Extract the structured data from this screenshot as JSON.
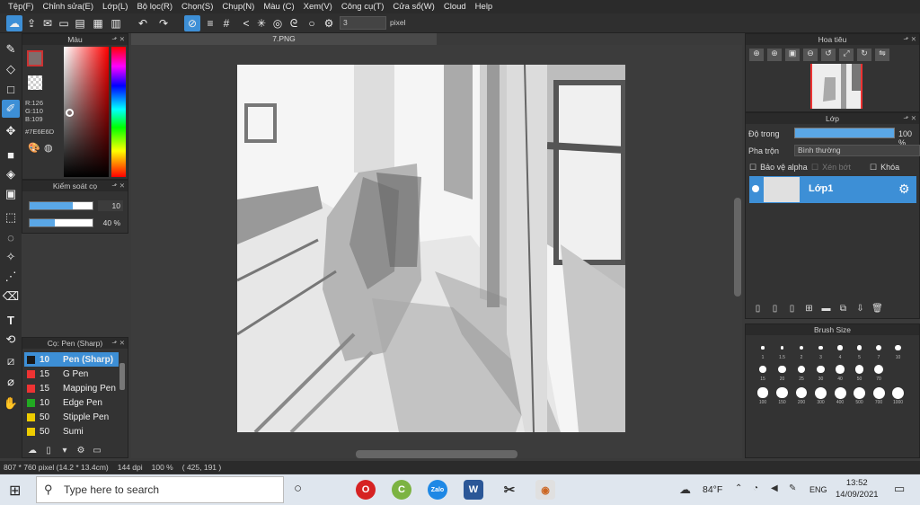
{
  "menu": [
    "Tệp(F)",
    "Chỉnh sửa(E)",
    "Lớp(L)",
    "Bộ lọc(R)",
    "Chọn(S)",
    "Chụp(N)",
    "Màu (C)",
    "Xem(V)",
    "Công cụ(T)",
    "Cửa sổ(W)",
    "Cloud",
    "Help"
  ],
  "toolbar": {
    "brush_size_value": "3",
    "unit_label": "pixel"
  },
  "color_panel": {
    "title": "Màu",
    "r": "R:126",
    "g": "G:110",
    "b": "B:109",
    "hex": "#7E6E6D",
    "fg_color": "#7E6E6D"
  },
  "brush_control": {
    "title": "Kiểm soát cọ",
    "size_value": "10",
    "size_fraction": 0.68,
    "opacity_value": "40 %",
    "opacity_fraction": 0.4
  },
  "brush_list": {
    "title": "Cọ: Pen (Sharp)",
    "items": [
      {
        "size": "10",
        "name": "Pen (Sharp)",
        "color": "#1a1a1a"
      },
      {
        "size": "15",
        "name": "G Pen",
        "color": "#e33"
      },
      {
        "size": "15",
        "name": "Mapping Pen",
        "color": "#e33"
      },
      {
        "size": "10",
        "name": "Edge Pen",
        "color": "#2a2"
      },
      {
        "size": "50",
        "name": "Stipple Pen",
        "color": "#ec0"
      },
      {
        "size": "50",
        "name": "Sumi",
        "color": "#ec0"
      }
    ]
  },
  "document": {
    "tab": "7.PNG"
  },
  "navigator": {
    "title": "Hoa tiêu"
  },
  "layer_panel": {
    "title": "Lớp",
    "opacity_label": "Độ trong",
    "opacity_value": "100 %",
    "blend_label": "Pha trộn",
    "blend_value": "Bình thường",
    "protect_alpha": "Bảo vệ alpha",
    "clipping": "Xén bớt",
    "lock": "Khóa",
    "layer_name": "Lớp1"
  },
  "brush_size_panel": {
    "title": "Brush Size",
    "labels": [
      "1",
      "1.5",
      "2",
      "3",
      "4",
      "5",
      "7",
      "10",
      "15",
      "20",
      "25",
      "30",
      "40",
      "50",
      "70",
      "100",
      "150",
      "200",
      "300",
      "400",
      "500",
      "700",
      "1000"
    ]
  },
  "status": {
    "dimensions": "807 * 760 pixel",
    "size_cm": "(14.2 * 13.4cm)",
    "dpi": "144 dpi",
    "zoom": "100 %",
    "coords": "( 425, 191 )"
  },
  "taskbar": {
    "search_placeholder": "Type here to search",
    "weather": "84°F",
    "lang": "ENG",
    "time": "13:52",
    "date": "14/09/2021"
  }
}
